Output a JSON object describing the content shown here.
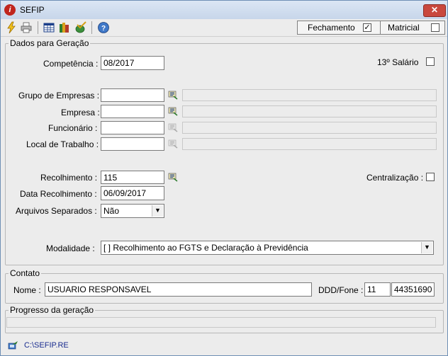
{
  "window": {
    "title": "SEFIP",
    "close_label": "✕"
  },
  "toolbar": {
    "icons": [
      "lightning-icon",
      "printer-icon",
      "table-icon",
      "books-icon",
      "chart-check-icon",
      "help-icon"
    ],
    "fechamento_label": "Fechamento",
    "fechamento_checked": "✓",
    "matricial_label": "Matricial",
    "matricial_checked": ""
  },
  "dados": {
    "title": "Dados para Geração",
    "competencia_label": "Competência :",
    "competencia_value": "08/2017",
    "salario13_label": "13º Salário",
    "grupo_label": "Grupo de Empresas :",
    "empresa_label": "Empresa :",
    "funcionario_label": "Funcionário :",
    "local_label": "Local de Trabalho :",
    "recolhimento_label": "Recolhimento :",
    "recolhimento_value": "115",
    "centralizacao_label": "Centralização :",
    "data_recolhimento_label": "Data Recolhimento :",
    "data_recolhimento_value": "06/09/2017",
    "arquivos_label": "Arquivos Separados :",
    "arquivos_value": "Não",
    "modalidade_label": "Modalidade :",
    "modalidade_value": "[  ] Recolhimento ao FGTS e Declaração à Previdência"
  },
  "contato": {
    "title": "Contato",
    "nome_label": "Nome :",
    "nome_value": "USUARIO RESPONSAVEL",
    "ddd_label": "DDD/Fone :",
    "ddd_value": "11",
    "fone_value": "44351690"
  },
  "progresso": {
    "title": "Progresso da geração",
    "value": 0
  },
  "status": {
    "path": "C:\\SEFIP.RE"
  }
}
